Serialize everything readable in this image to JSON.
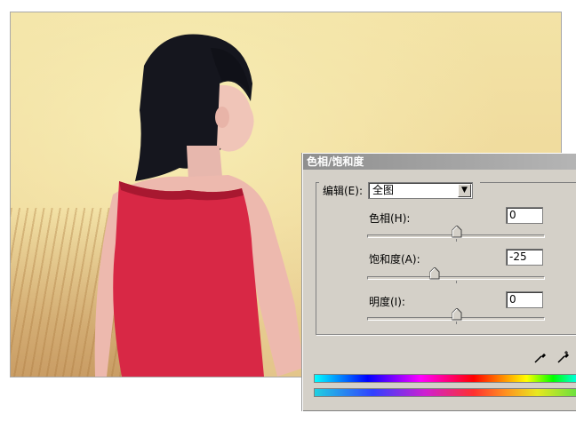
{
  "photo": {
    "description_icon": "portrait-photo"
  },
  "dialog": {
    "title": "色相/饱和度",
    "edit_label": "编辑(E):",
    "edit_value": "全图",
    "hue": {
      "label": "色相(H):",
      "value": "0",
      "level": 0
    },
    "saturation": {
      "label": "饱和度(A):",
      "value": "-25",
      "level": -25
    },
    "lightness": {
      "label": "明度(I):",
      "value": "0",
      "level": 0
    },
    "colors": {
      "title_gradient_start": "#8f8f8f",
      "panel": "#d4d0c8"
    }
  }
}
